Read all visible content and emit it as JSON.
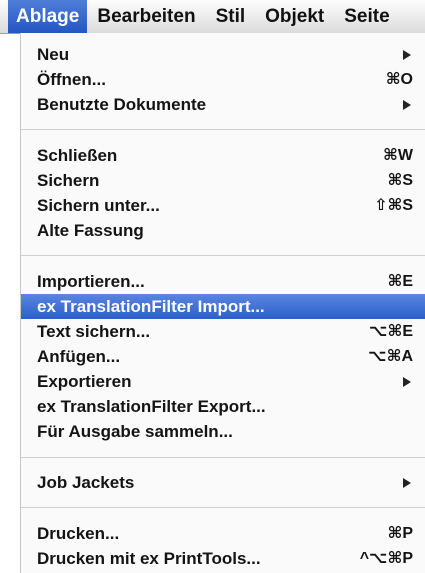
{
  "menubar": {
    "items": [
      "Ablage",
      "Bearbeiten",
      "Stil",
      "Objekt",
      "Seite"
    ]
  },
  "menu": {
    "items": [
      {
        "label": "Neu",
        "shortcut": "",
        "submenu": true
      },
      {
        "label": "Öffnen...",
        "shortcut": "⌘O",
        "submenu": false
      },
      {
        "label": "Benutzte Dokumente",
        "shortcut": "",
        "submenu": true
      },
      {
        "label": "Schließen",
        "shortcut": "⌘W",
        "submenu": false
      },
      {
        "label": "Sichern",
        "shortcut": "⌘S",
        "submenu": false
      },
      {
        "label": "Sichern unter...",
        "shortcut": "⇧⌘S",
        "submenu": false
      },
      {
        "label": "Alte Fassung",
        "shortcut": "",
        "submenu": false
      },
      {
        "label": "Importieren...",
        "shortcut": "⌘E",
        "submenu": false
      },
      {
        "label": "ex TranslationFilter Import...",
        "shortcut": "",
        "submenu": false,
        "highlighted": true
      },
      {
        "label": "Text sichern...",
        "shortcut": "⌥⌘E",
        "submenu": false
      },
      {
        "label": "Anfügen...",
        "shortcut": "⌥⌘A",
        "submenu": false
      },
      {
        "label": "Exportieren",
        "shortcut": "",
        "submenu": true
      },
      {
        "label": "ex TranslationFilter Export...",
        "shortcut": "",
        "submenu": false
      },
      {
        "label": "Für Ausgabe sammeln...",
        "shortcut": "",
        "submenu": false
      },
      {
        "label": "Job Jackets",
        "shortcut": "",
        "submenu": true
      },
      {
        "label": "Drucken...",
        "shortcut": "⌘P",
        "submenu": false
      },
      {
        "label": "Drucken mit ex PrintTools...",
        "shortcut": "^⌥⌘P",
        "submenu": false
      }
    ]
  },
  "colors": {
    "highlight": "#2b5fcd",
    "menu_background": "#fafafa"
  }
}
